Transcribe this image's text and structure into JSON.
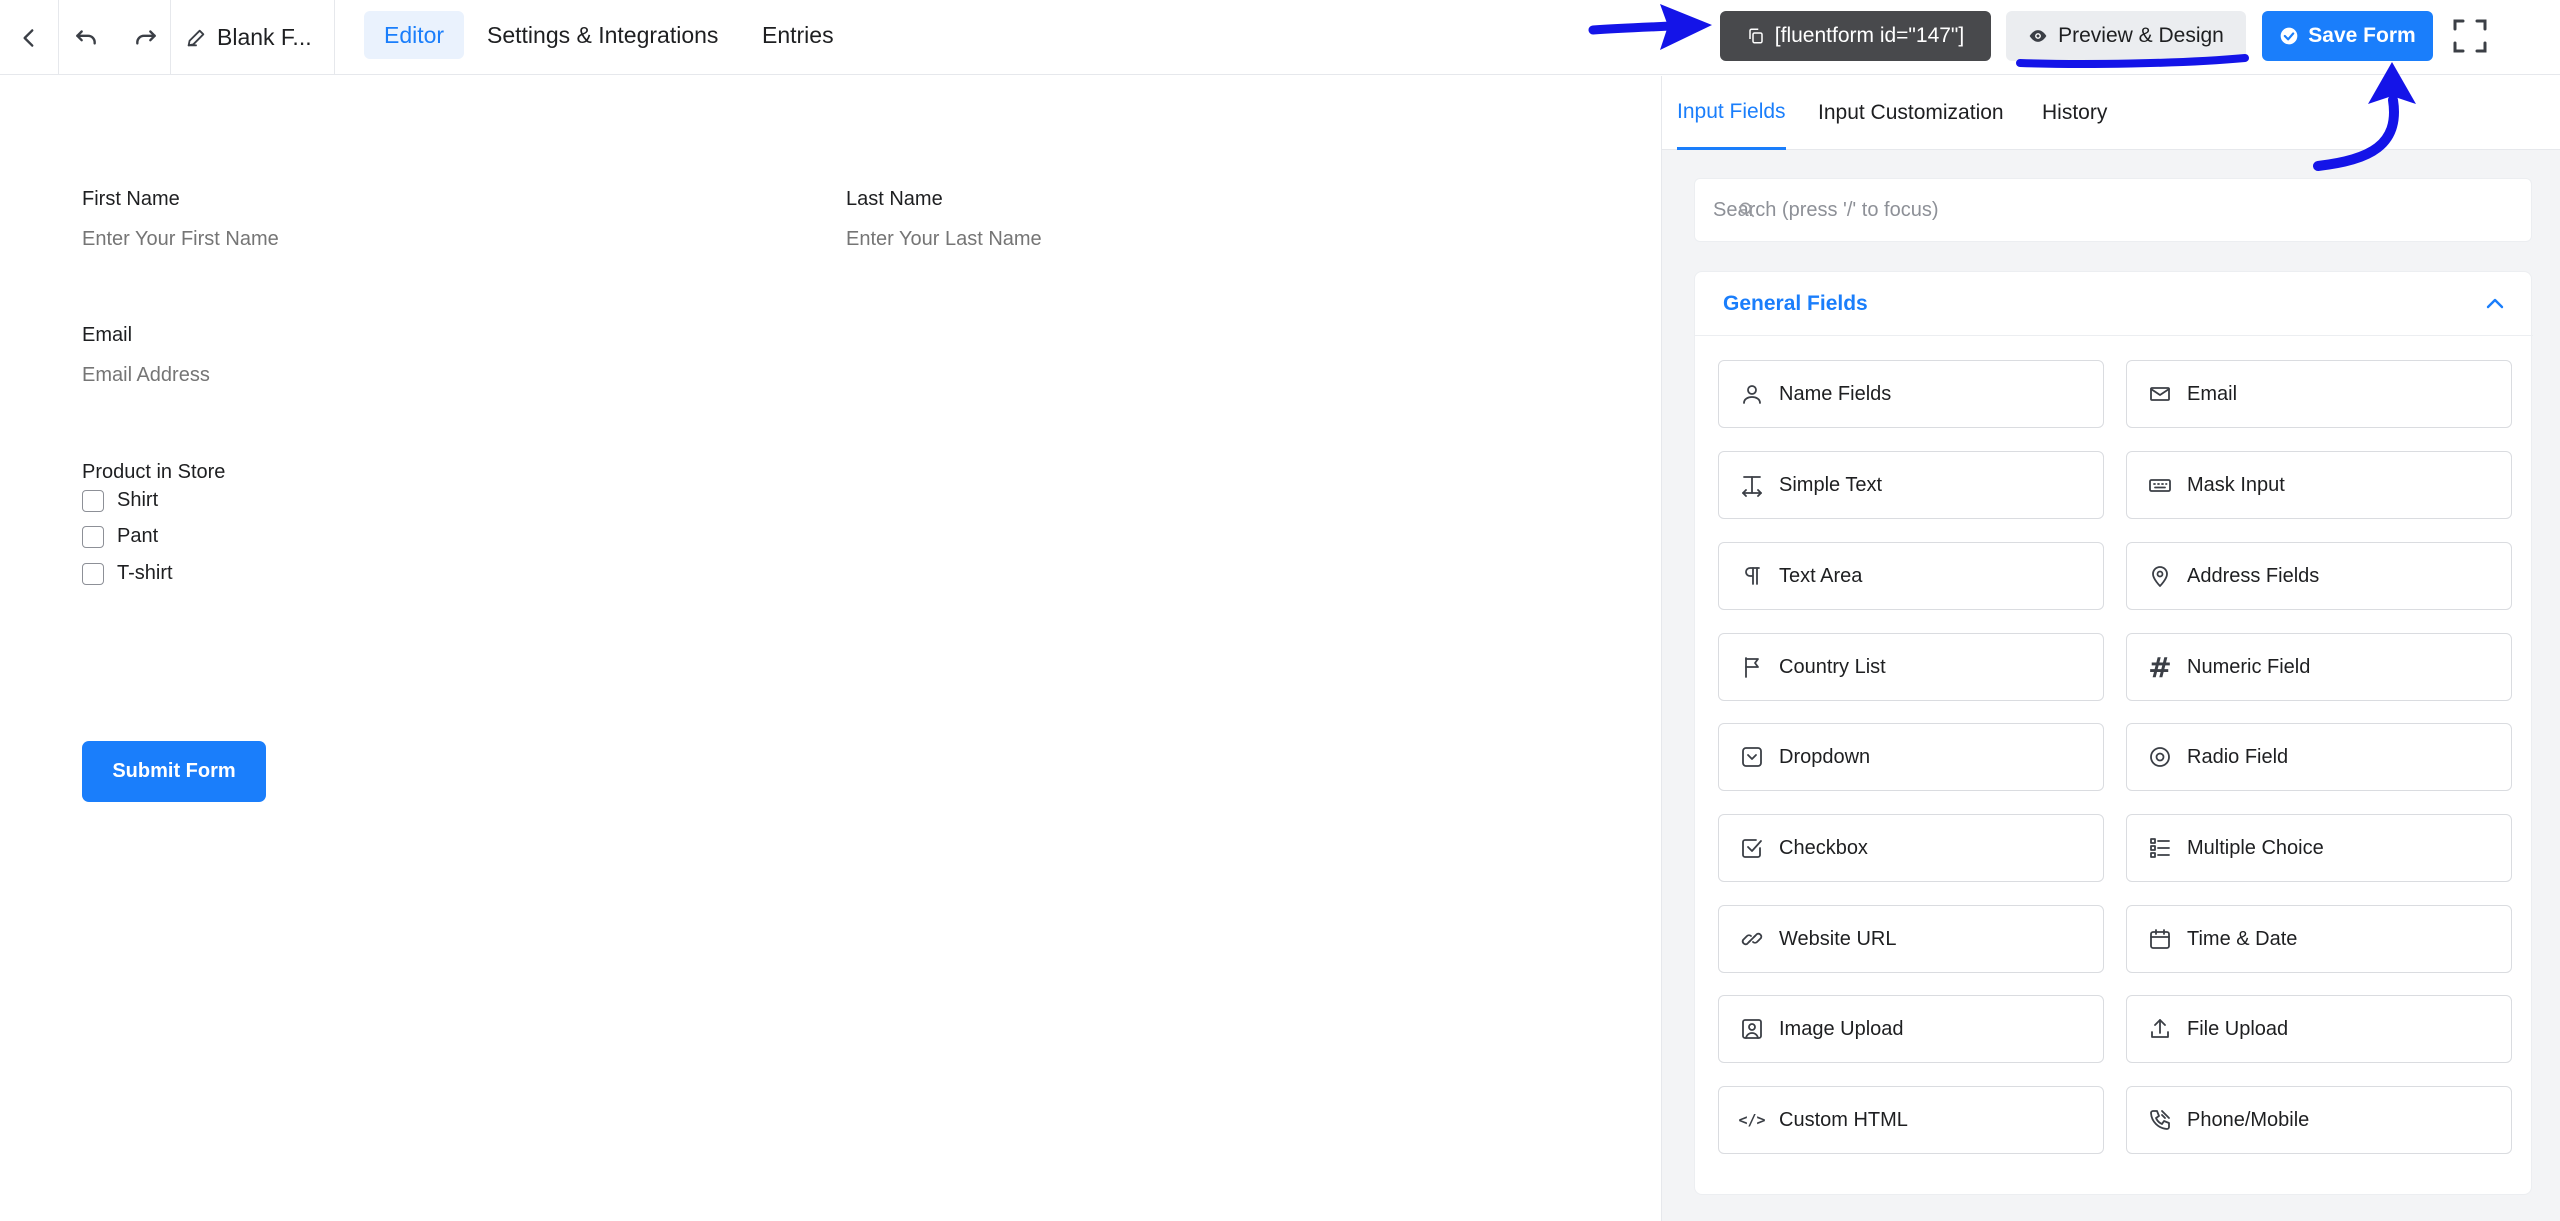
{
  "topbar": {
    "form_name": "Blank F...",
    "tabs": [
      {
        "label": "Editor",
        "active": true
      },
      {
        "label": "Settings & Integrations",
        "active": false
      },
      {
        "label": "Entries",
        "active": false
      }
    ],
    "shortcode": "[fluentform id=\"147\"]",
    "preview_label": "Preview & Design",
    "save_label": "Save Form"
  },
  "form": {
    "first_name": {
      "label": "First Name",
      "placeholder": "Enter Your First Name"
    },
    "last_name": {
      "label": "Last Name",
      "placeholder": "Enter Your Last Name"
    },
    "email": {
      "label": "Email",
      "placeholder": "Email Address"
    },
    "product": {
      "label": "Product in Store",
      "options": [
        "Shirt",
        "Pant",
        "T-shirt"
      ]
    },
    "submit_label": "Submit Form"
  },
  "panel": {
    "tabs": [
      {
        "label": "Input Fields",
        "active": true
      },
      {
        "label": "Input Customization",
        "active": false
      },
      {
        "label": "History",
        "active": false
      }
    ],
    "search_placeholder": "Search (press '/' to focus)",
    "general_fields": {
      "title": "General Fields",
      "fields": [
        {
          "label": "Name Fields",
          "icon": "user-icon"
        },
        {
          "label": "Email",
          "icon": "envelope-icon"
        },
        {
          "label": "Simple Text",
          "icon": "text-cursor-icon"
        },
        {
          "label": "Mask Input",
          "icon": "keyboard-icon"
        },
        {
          "label": "Text Area",
          "icon": "paragraph-icon"
        },
        {
          "label": "Address Fields",
          "icon": "map-pin-icon"
        },
        {
          "label": "Country List",
          "icon": "flag-icon"
        },
        {
          "label": "Numeric Field",
          "icon": "hash-icon"
        },
        {
          "label": "Dropdown",
          "icon": "dropdown-icon"
        },
        {
          "label": "Radio Field",
          "icon": "radio-icon"
        },
        {
          "label": "Checkbox",
          "icon": "checkbox-icon"
        },
        {
          "label": "Multiple Choice",
          "icon": "list-icon"
        },
        {
          "label": "Website URL",
          "icon": "link-icon"
        },
        {
          "label": "Time & Date",
          "icon": "calendar-icon"
        },
        {
          "label": "Image Upload",
          "icon": "image-icon"
        },
        {
          "label": "File Upload",
          "icon": "upload-icon"
        },
        {
          "label": "Custom HTML",
          "icon": "code-icon"
        },
        {
          "label": "Phone/Mobile",
          "icon": "phone-icon"
        }
      ]
    }
  },
  "colors": {
    "accent": "#1a7efb",
    "annotation": "#1414e8",
    "shortcode_bg": "#48494c"
  }
}
